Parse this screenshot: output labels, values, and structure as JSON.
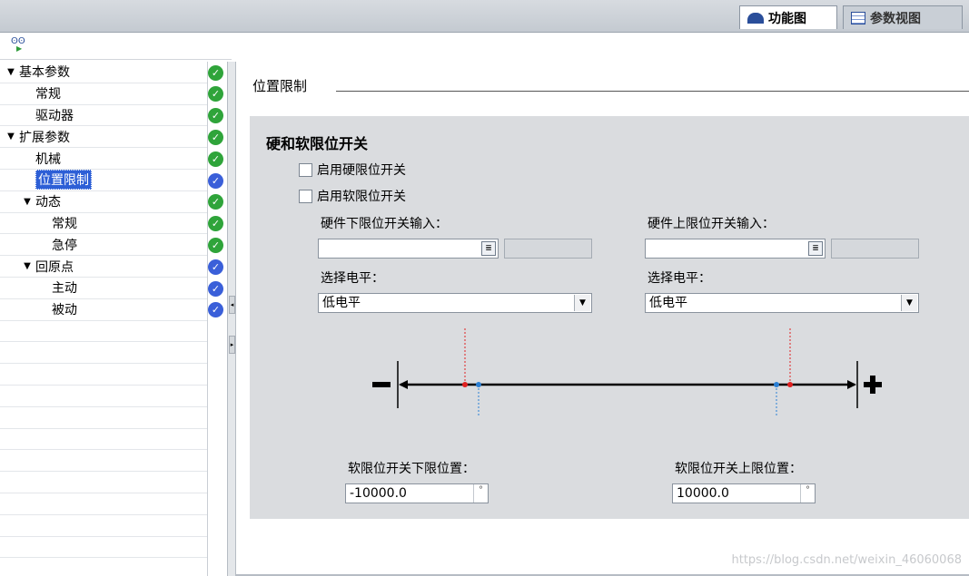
{
  "tabs": {
    "function_view": "功能图",
    "param_view": "参数视图"
  },
  "tree": {
    "items": [
      {
        "label": "基本参数",
        "toggle": "▼",
        "indent": 0,
        "status": "ok"
      },
      {
        "label": "常规",
        "toggle": "",
        "indent": 1,
        "status": "ok"
      },
      {
        "label": "驱动器",
        "toggle": "",
        "indent": 1,
        "status": "ok"
      },
      {
        "label": "扩展参数",
        "toggle": "▼",
        "indent": 0,
        "status": "ok"
      },
      {
        "label": "机械",
        "toggle": "",
        "indent": 1,
        "status": "ok"
      },
      {
        "label": "位置限制",
        "toggle": "",
        "indent": 1,
        "status": "blue",
        "selected": true
      },
      {
        "label": "动态",
        "toggle": "▼",
        "indent": 1,
        "status": "ok"
      },
      {
        "label": "常规",
        "toggle": "",
        "indent": 2,
        "status": "ok"
      },
      {
        "label": "急停",
        "toggle": "",
        "indent": 2,
        "status": "ok"
      },
      {
        "label": "回原点",
        "toggle": "▼",
        "indent": 1,
        "status": "blue"
      },
      {
        "label": "主动",
        "toggle": "",
        "indent": 2,
        "status": "blue"
      },
      {
        "label": "被动",
        "toggle": "",
        "indent": 2,
        "status": "blue"
      }
    ]
  },
  "section": {
    "title": "位置限制"
  },
  "panel": {
    "title": "硬和软限位开关",
    "enable_hw": "启用硬限位开关",
    "enable_sw": "启用软限位开关",
    "hw_lower_label": "硬件下限位开关输入：",
    "hw_upper_label": "硬件上限位开关输入：",
    "hw_lower_value": "",
    "hw_upper_value": "",
    "level_label_left": "选择电平：",
    "level_label_right": "选择电平：",
    "level_left_value": "低电平",
    "level_right_value": "低电平",
    "sw_lower_label": "软限位开关下限位置：",
    "sw_upper_label": "软限位开关上限位置：",
    "sw_lower_value": "-10000.0",
    "sw_upper_value": "10000.0",
    "unit_symbol": "°"
  },
  "diagram": {
    "minus": "−",
    "plus": "+",
    "colors": {
      "red": "#e02020",
      "blue": "#2a7fd4",
      "line": "#000000"
    }
  },
  "watermark": "https://blog.csdn.net/weixin_46060068"
}
